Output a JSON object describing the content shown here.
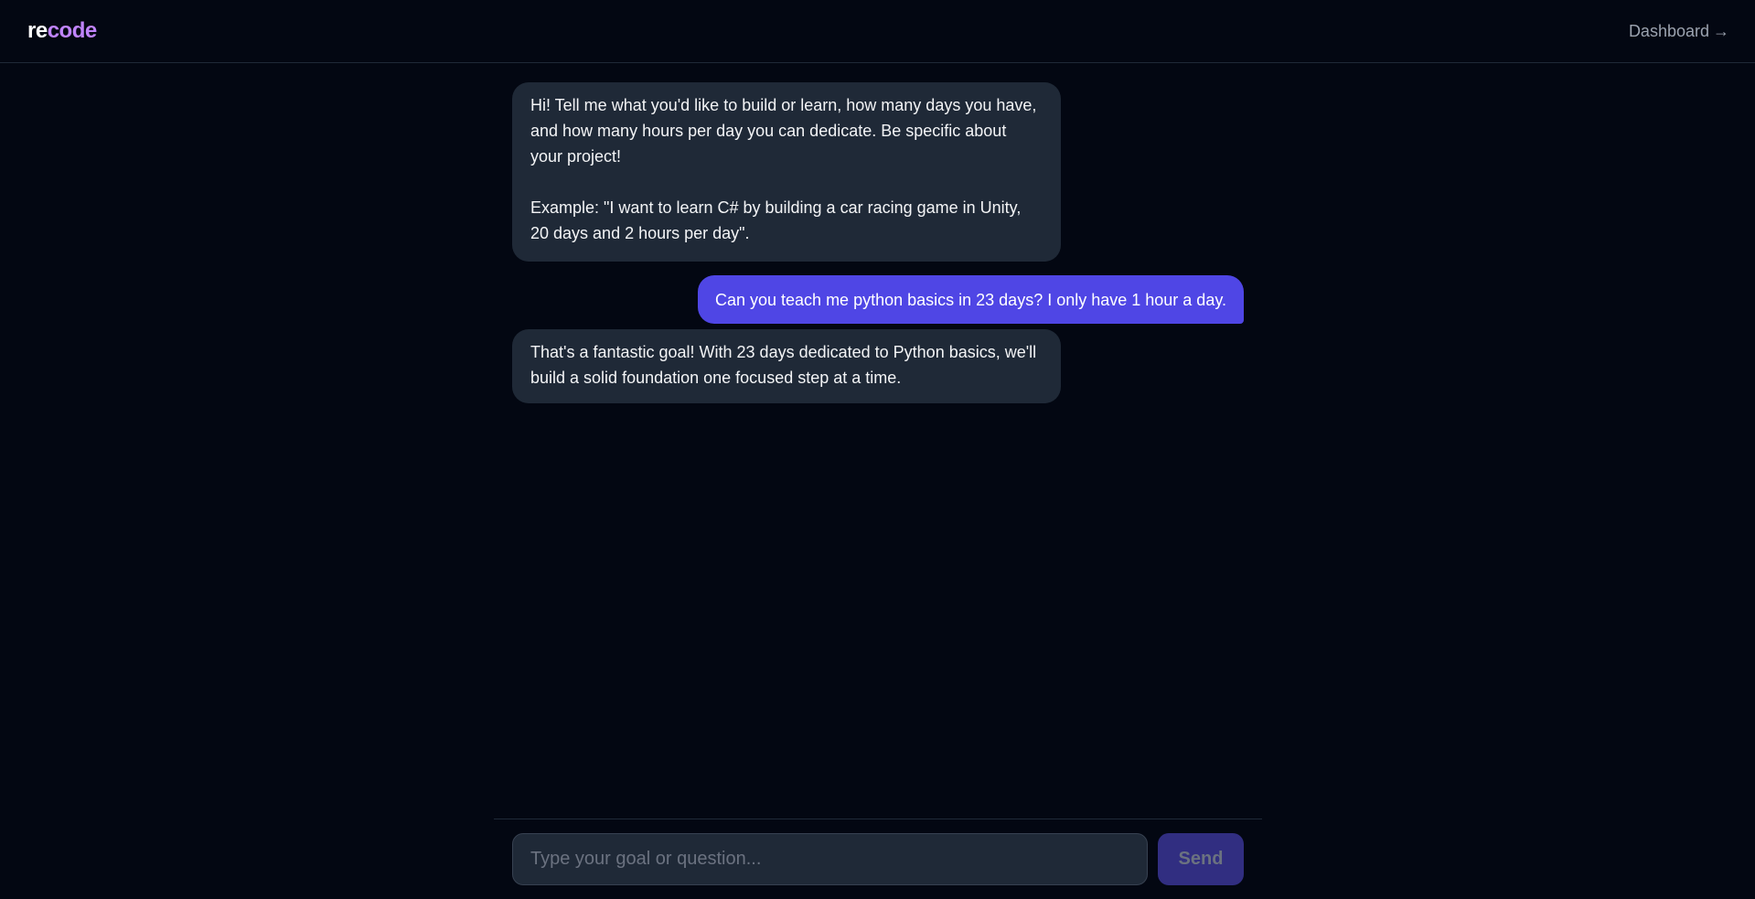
{
  "header": {
    "logo_part1": "re",
    "logo_part2": "code",
    "dashboard_label": "Dashboard",
    "arrow": "→"
  },
  "messages": [
    {
      "role": "assistant",
      "text": "Hi! Tell me what you'd like to build or learn, how many days you have, and how many hours per day you can dedicate. Be specific about your project!\n\nExample: \"I want to learn C# by building a car racing game in Unity, 20 days and 2 hours per day\"."
    },
    {
      "role": "user",
      "text": "Can you teach me python basics in 23 days? I only have 1 hour a day."
    },
    {
      "role": "assistant",
      "text": "That's a fantastic goal! With 23 days dedicated to Python basics, we'll build a solid foundation one focused step at a time."
    }
  ],
  "composer": {
    "placeholder": "Type your goal or question...",
    "value": "",
    "send_label": "Send"
  },
  "colors": {
    "background": "#030712",
    "assistant_bubble": "#1f2937",
    "user_bubble": "#4f46e5",
    "logo_accent": "#c084fc",
    "send_button_disabled": "#312e81"
  }
}
